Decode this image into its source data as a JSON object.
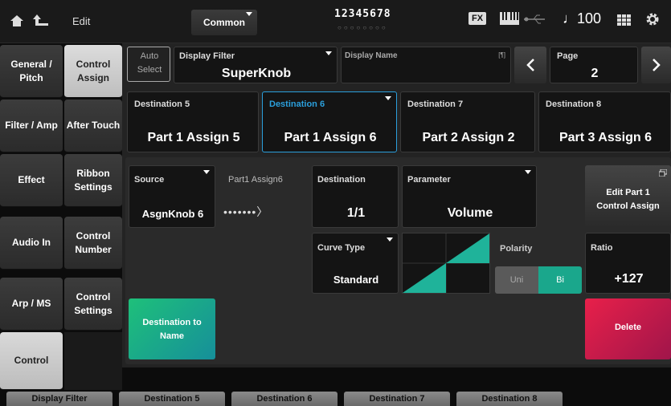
{
  "header": {
    "edit_label": "Edit",
    "common_tab": "Common",
    "part_numbers": "12345678",
    "part_dots": "○○○○○○○○",
    "fx_badge": "FX",
    "tempo": "♩100"
  },
  "left_tabs": [
    {
      "label": "General / Pitch"
    },
    {
      "label": "Filter / Amp"
    },
    {
      "label": "Effect"
    },
    {
      "label": "Audio In"
    },
    {
      "label": "Arp / MS"
    },
    {
      "label": "Control"
    }
  ],
  "sub_tabs": [
    {
      "label": "Control Assign"
    },
    {
      "label": "After Touch"
    },
    {
      "label": "Ribbon Settings"
    },
    {
      "label": "Control Number"
    },
    {
      "label": "Control Settings"
    }
  ],
  "top_row": {
    "auto_select": "Auto Select",
    "display_filter_label": "Display Filter",
    "display_filter_value": "SuperKnob",
    "display_name_label": "Display Name",
    "display_name_mark": "[¶]",
    "page_label": "Page",
    "page_value": "2"
  },
  "destinations": [
    {
      "label": "Destination 5",
      "value": "Part 1 Assign 5"
    },
    {
      "label": "Destination 6",
      "value": "Part 1 Assign 6"
    },
    {
      "label": "Destination 7",
      "value": "Part 2 Assign 2"
    },
    {
      "label": "Destination 8",
      "value": "Part 3 Assign 6"
    }
  ],
  "detail": {
    "source_label": "Source",
    "source_value": "AsgnKnob 6",
    "assign_label": "Part1 Assign6",
    "assign_arrow": "•••••••〉",
    "destination_label": "Destination",
    "destination_value": "1/1",
    "parameter_label": "Parameter",
    "parameter_value": "Volume",
    "edit_button": "Edit Part 1 Control Assign",
    "curve_type_label": "Curve Type",
    "curve_type_value": "Standard",
    "polarity_label": "Polarity",
    "polarity_uni": "Uni",
    "polarity_bi": "Bi",
    "ratio_label": "Ratio",
    "ratio_value": "+127",
    "dest_to_name_button": "Destination to Name",
    "delete_button": "Delete"
  },
  "bottom_tabs": [
    {
      "label": "Display Filter"
    },
    {
      "label": "Destination 5"
    },
    {
      "label": "Destination 6"
    },
    {
      "label": "Destination 7"
    },
    {
      "label": "Destination 8"
    }
  ],
  "colors": {
    "accent_teal": "#1fb39a",
    "accent_blue": "#2b9fdc",
    "delete_red": "#d01a4a",
    "dest_btn_green": "#19a87f"
  }
}
